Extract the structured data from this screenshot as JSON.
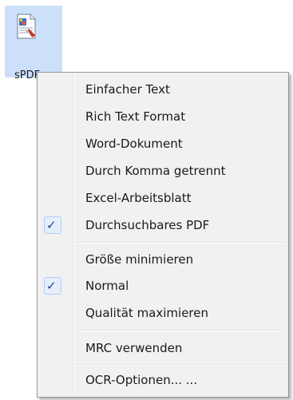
{
  "desktop": {
    "icon_name": "document-image-icon",
    "caption": "sPDF"
  },
  "menu": {
    "groups": [
      {
        "items": [
          {
            "label": "Einfacher Text",
            "checked": false
          },
          {
            "label": "Rich Text Format",
            "checked": false
          },
          {
            "label": "Word-Dokument",
            "checked": false
          },
          {
            "label": "Durch Komma getrennt",
            "checked": false
          },
          {
            "label": "Excel-Arbeitsblatt",
            "checked": false
          },
          {
            "label": "Durchsuchbares PDF",
            "checked": true
          }
        ]
      },
      {
        "items": [
          {
            "label": "Größe minimieren",
            "checked": false
          },
          {
            "label": "Normal",
            "checked": true
          },
          {
            "label": "Qualität maximieren",
            "checked": false
          }
        ]
      },
      {
        "items": [
          {
            "label": "MRC verwenden",
            "checked": false
          }
        ]
      },
      {
        "items": [
          {
            "label": "OCR-Optionen... ...",
            "checked": false
          }
        ]
      }
    ],
    "check_glyph": "✓",
    "colors": {
      "background": "#f1f1f1",
      "border": "#979797",
      "check": "#1f3f86",
      "check_highlight": "#e6eefb"
    }
  }
}
